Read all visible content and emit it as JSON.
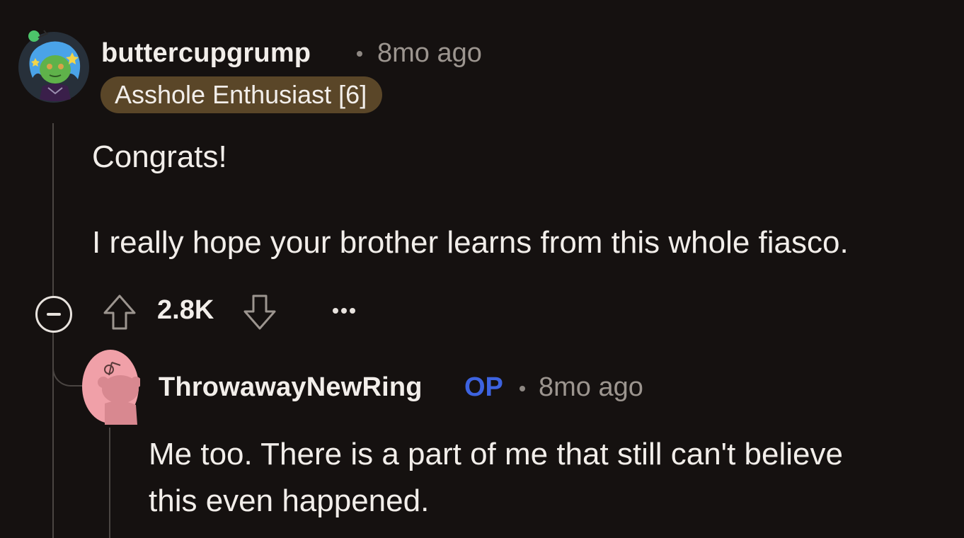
{
  "comment": {
    "author": "buttercupgrump",
    "timestamp": "8mo ago",
    "flair": "Asshole Enthusiast [6]",
    "body_line1": "Congrats!",
    "body_line2": "I really hope your brother learns from this whole fiasco.",
    "score": "2.8K",
    "avatar_icon": "snoo-avatar-green-alien-blue-hair"
  },
  "reply": {
    "author": "ThrowawayNewRing",
    "op_label": "OP",
    "timestamp": "8mo ago",
    "body_line1": "Me too. There is a part of me that still can't believe",
    "body_line2": "this even happened.",
    "avatar_icon": "default-snoo-avatar-pink"
  },
  "colors": {
    "background": "#151110",
    "text": "#f2eeea",
    "muted": "#9c958f",
    "op": "#3d63e0",
    "flair_bg": "#5a4628"
  }
}
